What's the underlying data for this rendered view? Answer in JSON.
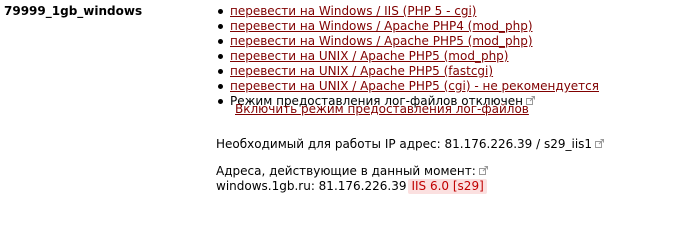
{
  "account": {
    "name": "79999_1gb_windows"
  },
  "options": [
    {
      "label": "перевести на Windows / IIS (PHP 5 - cgi)"
    },
    {
      "label": "перевести на Windows / Apache PHP4 (mod_php)"
    },
    {
      "label": "перевести на Windows / Apache PHP5 (mod_php)"
    },
    {
      "label": "перевести на UNIX / Apache PHP5 (mod_php)"
    },
    {
      "label": "перевести на UNIX / Apache PHP5 (fastcgi)"
    },
    {
      "label": "перевести на UNIX / Apache PHP5 (cgi) - не рекомендуется"
    }
  ],
  "logs": {
    "status_text": "Режим предоставления лог-файлов отключен",
    "enable_label": "Включить режим предоставления лог-файлов"
  },
  "ip": {
    "required_text": "Необходимый для работы IP адрес: 81.176.226.39 / s29_iis1"
  },
  "current": {
    "heading": "Адреса, действующие в данный момент:",
    "domain_text": "windows.1gb.ru: 81.176.226.39",
    "server_badge": "IIS 6.0 [s29]"
  },
  "colors": {
    "link": "#800000",
    "badge_bg": "#fbe0e0",
    "badge_text": "#c00000"
  }
}
